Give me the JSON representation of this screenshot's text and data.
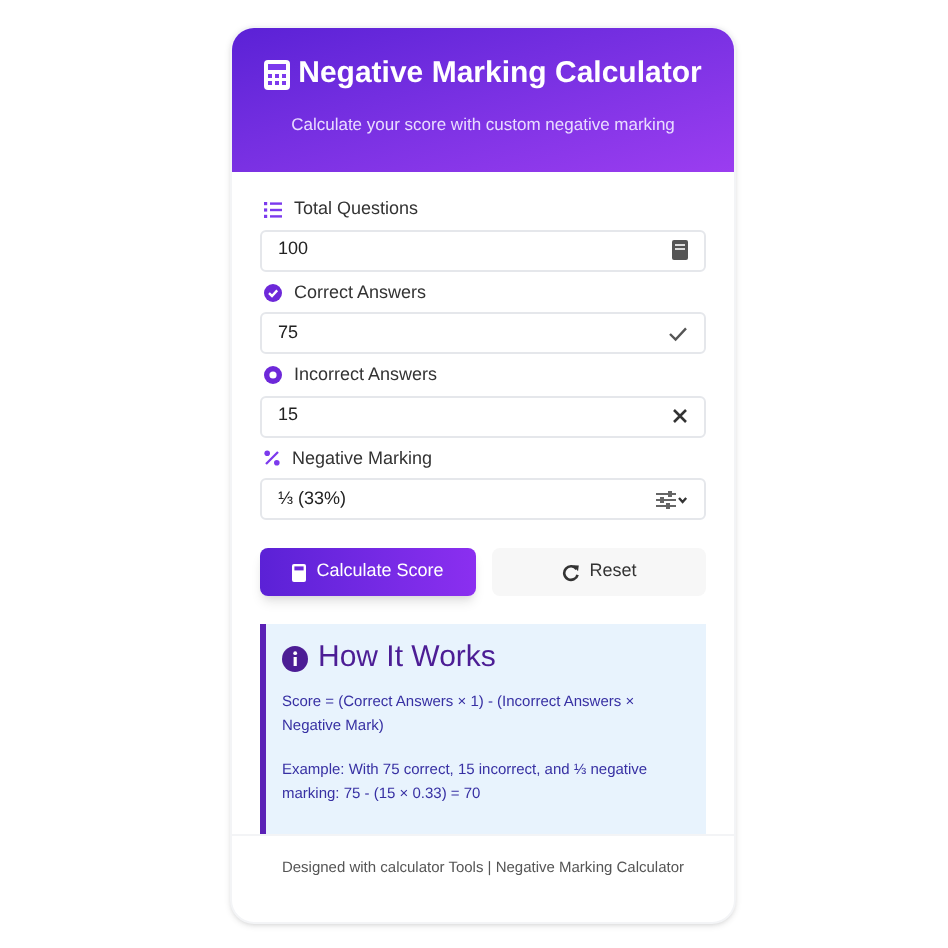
{
  "header": {
    "title": "Negative Marking Calculator",
    "subtitle": "Calculate your score with custom negative marking"
  },
  "fields": [
    {
      "kind": "total",
      "label": "Total Questions",
      "value": "100"
    },
    {
      "kind": "correct",
      "label": "Correct Answers",
      "value": "75"
    },
    {
      "kind": "incorrect",
      "label": "Incorrect Answers",
      "value": "15"
    },
    {
      "kind": "select",
      "label": "Negative Marking",
      "value": "⅓ (33%)"
    }
  ],
  "buttons": [
    {
      "kind": "primary",
      "label": "Calculate Score"
    },
    {
      "kind": "secondary",
      "label": "Reset"
    }
  ],
  "info": {
    "title": "How It Works",
    "paragraphs": [
      "Score = (Correct Answers × 1) - (Incorrect Answers × Negative Mark)",
      "Example: With 75 correct, 15 incorrect, and ⅓ negative marking: 75 - (15 × 0.33) = 70"
    ]
  },
  "footer": "Designed with calculator Tools | Negative Marking Calculator"
}
